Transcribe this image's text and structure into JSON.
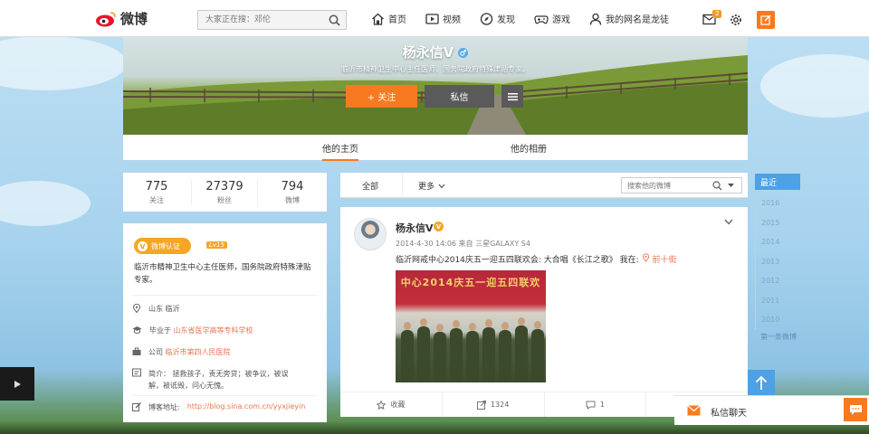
{
  "topnav": {
    "logo_text": "微博",
    "search_placeholder": "大家正在搜：邓伦",
    "items": [
      {
        "label": "首页",
        "icon": "home-icon"
      },
      {
        "label": "视频",
        "icon": "video-icon"
      },
      {
        "label": "发现",
        "icon": "discover-icon"
      },
      {
        "label": "游戏",
        "icon": "game-icon"
      },
      {
        "label": "我的网名是龙徒",
        "icon": "user-icon"
      }
    ],
    "message_badge": "2"
  },
  "profile": {
    "name": "杨永信V",
    "bio": "临沂市精神卫生中心主任医师，国务院政府特殊津贴专家。",
    "follow_label": "+ 关注",
    "message_label": "私信",
    "tabs": [
      {
        "label": "他的主页",
        "active": true
      },
      {
        "label": "他的相册",
        "active": false
      }
    ]
  },
  "stats": [
    {
      "value": "775",
      "label": "关注"
    },
    {
      "value": "27379",
      "label": "粉丝"
    },
    {
      "value": "794",
      "label": "微博"
    }
  ],
  "intro": {
    "verified_label": "微博认证",
    "level": "Lv15",
    "description": "临沂市精神卫生中心主任医师，国务院政府特殊津贴专家。",
    "location": "山东 临沂",
    "school_prefix": "毕业于",
    "school": "山东省医学高等专科学校",
    "company_prefix": "公司",
    "company": "临沂市第四人民医院",
    "summary_line1": "简介：  拯救孩子，责无旁贷；被争议，被误",
    "summary_line2": "解，被诋毁，问心无愧。",
    "blog_label": "博客地址:",
    "blog_url": "http://blog.sina.com.cn/yyxjieyin"
  },
  "feed": {
    "tab_all": "全部",
    "tab_more": "更多",
    "search_placeholder": "搜索他的微博"
  },
  "post": {
    "author": "杨永信V",
    "meta": "2014-4-30 14:06 来自 三星GALAXY S4",
    "text": "临沂网戒中心2014庆五一迎五四联欢会: 大合唱《长江之歌》 我在: ",
    "location": "前十街",
    "image_banner": "中心2014庆五一迎五四联欢",
    "favorite_label": "收藏",
    "repost_count": "1324",
    "comment_count": "1"
  },
  "timeline": {
    "active": "最近",
    "years": [
      "2016",
      "2015",
      "2014",
      "2013",
      "2012",
      "2011",
      "2010"
    ],
    "first_post": "第一条微博"
  },
  "chat": {
    "label": "私信聊天"
  }
}
